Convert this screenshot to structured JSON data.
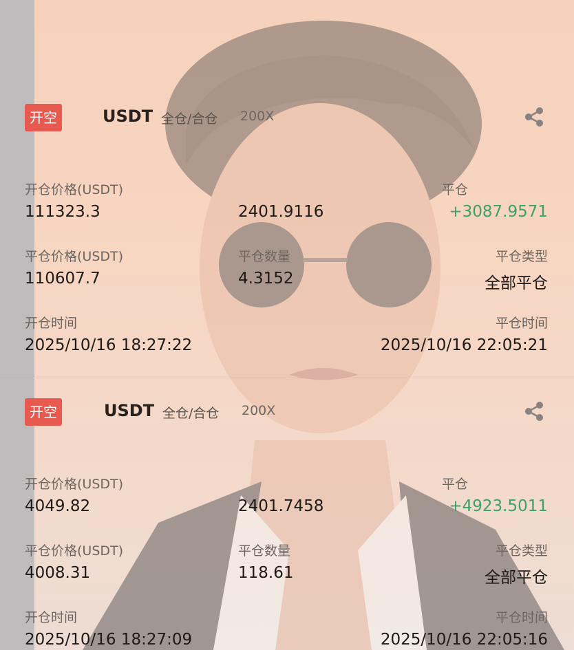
{
  "colors": {
    "tag_bg": "#e85a4f",
    "profit_green": "#3ea06a",
    "text_dark": "#1e1a17",
    "label_gray": "#6b6560"
  },
  "positions": [
    {
      "side_tag": "开空",
      "symbol": "USDT",
      "margin_mode": "全仓/合仓",
      "leverage": "200X",
      "share_icon": "share-icon",
      "open_price_label": "开仓价格(USDT)",
      "open_price": "111323.3",
      "qty_value": "2401.9116",
      "pnl_label": "平仓",
      "pnl_value": "+3087.9571",
      "close_price_label": "平仓价格(USDT)",
      "close_price": "110607.7",
      "close_qty_label": "平仓数量",
      "close_qty": "4.3152",
      "close_type_label": "平仓类型",
      "close_type": "全部平仓",
      "open_time_label": "开仓时间",
      "open_time": "2025/10/16 18:27:22",
      "close_time_label": "平仓时间",
      "close_time": "2025/10/16 22:05:21"
    },
    {
      "side_tag": "开空",
      "symbol": "USDT",
      "margin_mode": "全仓/合仓",
      "leverage": "200X",
      "share_icon": "share-icon",
      "open_price_label": "开仓价格(USDT)",
      "open_price": "4049.82",
      "qty_value": "2401.7458",
      "pnl_label": "平仓",
      "pnl_value": "+4923.5011",
      "close_price_label": "平仓价格(USDT)",
      "close_price": "4008.31",
      "close_qty_label": "平仓数量",
      "close_qty": "118.61",
      "close_type_label": "平仓类型",
      "close_type": "全部平仓",
      "open_time_label": "开仓时间",
      "open_time": "2025/10/16 18:27:09",
      "close_time_label": "平仓时间",
      "close_time": "2025/10/16 22:05:16"
    }
  ]
}
